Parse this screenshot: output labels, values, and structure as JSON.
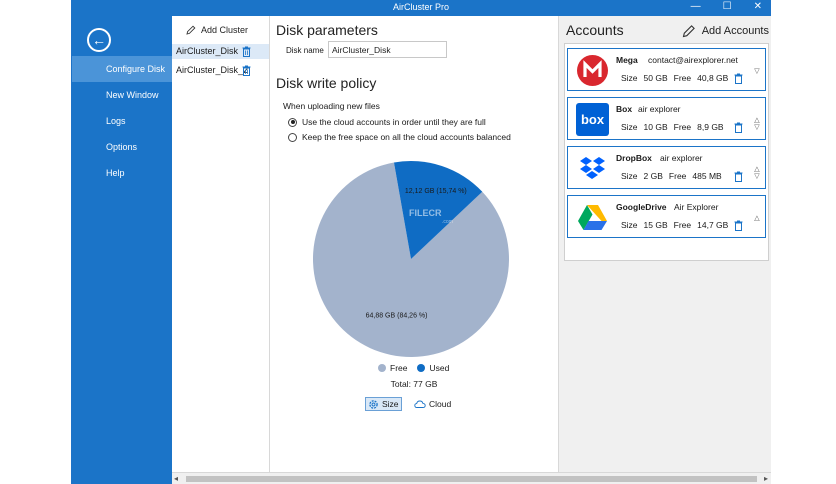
{
  "window": {
    "title": "AirCluster Pro",
    "controls": [
      "—",
      "☐",
      "✕"
    ]
  },
  "sidebar": {
    "back_symbol": "←",
    "items": [
      {
        "label": "Configure Disk",
        "active": true
      },
      {
        "label": "New Window",
        "active": false
      },
      {
        "label": "Logs",
        "active": false
      },
      {
        "label": "Options",
        "active": false
      },
      {
        "label": "Help",
        "active": false
      }
    ]
  },
  "clusters": {
    "add_label": "Add Cluster",
    "items": [
      {
        "name": "AirCluster_Disk",
        "selected": true
      },
      {
        "name": "AirCluster_Disk_2",
        "selected": false
      }
    ]
  },
  "disk_parameters": {
    "title": "Disk parameters",
    "name_label": "Disk name",
    "name_value": "AirCluster_Disk"
  },
  "write_policy": {
    "title": "Disk write policy",
    "upload_label": "When uploading new files",
    "options": [
      {
        "label": "Use the cloud accounts in order until they are full",
        "checked": true
      },
      {
        "label": "Keep the free space on all the cloud accounts balanced",
        "checked": false
      }
    ]
  },
  "chart_data": {
    "type": "pie",
    "slices": [
      {
        "name": "Free",
        "value": 64.88,
        "label": "64,88 GB (84,26 %)",
        "color": "#a3b3cc"
      },
      {
        "name": "Used",
        "value": 12.12,
        "label": "12,12 GB (15,74 %)",
        "color": "#0f6cc4"
      }
    ],
    "legend": [
      "Free",
      "Used"
    ],
    "total_label": "Total: 77 GB"
  },
  "view_toggle": {
    "size_label": "Size",
    "cloud_label": "Cloud",
    "active": "Size"
  },
  "watermark": {
    "text": "FILECR",
    "sub": ".com"
  },
  "accounts": {
    "title": "Accounts",
    "add_label": "Add Accounts",
    "size_label": "Size",
    "free_label": "Free",
    "items": [
      {
        "name": "Mega",
        "email": "contact@airexplorer.net",
        "size": "50 GB",
        "free": "40,8 GB",
        "logo": "mega-logo-icon",
        "arrows": [
          "",
          "▽"
        ]
      },
      {
        "name": "Box",
        "email": "air explorer",
        "size": "10 GB",
        "free": "8,9 GB",
        "logo": "box-logo-icon",
        "arrows": [
          "△",
          "▽"
        ]
      },
      {
        "name": "DropBox",
        "email": "air explorer",
        "size": "2 GB",
        "free": "485 MB",
        "logo": "dropbox-logo-icon",
        "arrows": [
          "△",
          "▽"
        ]
      },
      {
        "name": "GoogleDrive",
        "email": "Air Explorer",
        "size": "15 GB",
        "free": "14,7 GB",
        "logo": "google-drive-logo-icon",
        "arrows": [
          "△",
          ""
        ]
      }
    ]
  },
  "colors": {
    "accent": "#1b74c8",
    "sidebar_active": "#4b94d8",
    "mega_red": "#d9272e",
    "box_blue": "#0061d5",
    "dropbox_blue": "#0061fe"
  }
}
